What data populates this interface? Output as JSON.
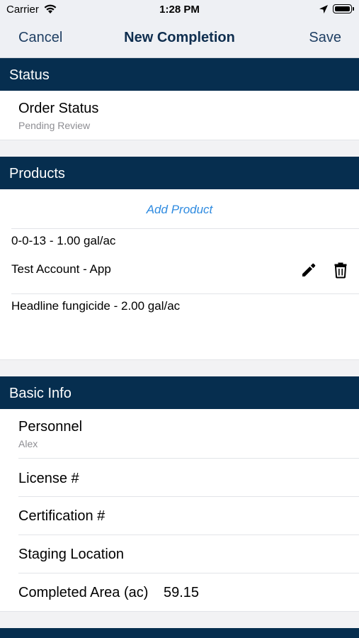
{
  "status_bar": {
    "carrier": "Carrier",
    "time": "1:28 PM"
  },
  "nav": {
    "cancel_label": "Cancel",
    "title": "New Completion",
    "save_label": "Save"
  },
  "status_section": {
    "header": "Status",
    "order_status_label": "Order Status",
    "order_status_value": "Pending Review"
  },
  "products_section": {
    "header": "Products",
    "add_product_label": "Add Product",
    "items": [
      {
        "line1": "0-0-13 - 1.00 gal/ac",
        "line2": "Test Account - App"
      },
      {
        "line1": "Headline fungicide - 2.00 gal/ac"
      }
    ]
  },
  "basic_info_section": {
    "header": "Basic Info",
    "personnel_label": "Personnel",
    "personnel_value": "Alex",
    "license_label": "License #",
    "certification_label": "Certification #",
    "staging_label": "Staging Location",
    "completed_area_label": "Completed Area (ac)",
    "completed_area_value": "59.15"
  },
  "colors": {
    "header_bg": "#062e4f",
    "nav_bg": "#eef0f4",
    "link_blue": "#2f8be0",
    "nav_text": "#1f3f63"
  },
  "icons": [
    "wifi-icon",
    "location-arrow-icon",
    "battery-icon",
    "pencil-icon",
    "trash-icon"
  ]
}
